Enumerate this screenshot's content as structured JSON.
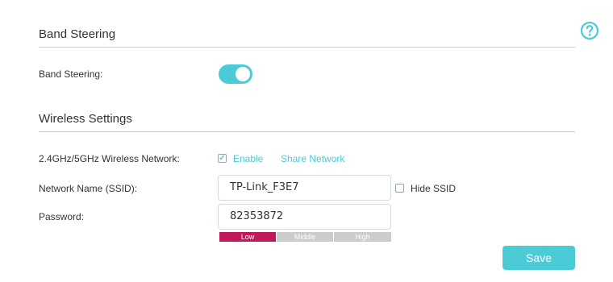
{
  "band_steering_section": {
    "title": "Band Steering",
    "label": "Band Steering:",
    "toggle_on": true
  },
  "wireless_section": {
    "title": "Wireless Settings",
    "network_label": "2.4GHz/5GHz Wireless Network:",
    "enable_label": "Enable",
    "enable_checked": true,
    "share_network_label": "Share Network",
    "ssid_label": "Network Name (SSID):",
    "ssid_value": "TP-Link_F3E7",
    "hide_ssid_label": "Hide SSID",
    "hide_ssid_checked": false,
    "password_label": "Password:",
    "password_value": "82353872",
    "strength": {
      "low": "Low",
      "middle": "Middle",
      "high": "High",
      "active_level": "Low"
    }
  },
  "colors": {
    "accent": "#4acbd6",
    "strength_low": "#c0175d",
    "strength_inactive": "#cccccc"
  },
  "actions": {
    "save_label": "Save"
  },
  "icons": {
    "help": "help-circle-icon",
    "check": "checkmark-icon"
  }
}
